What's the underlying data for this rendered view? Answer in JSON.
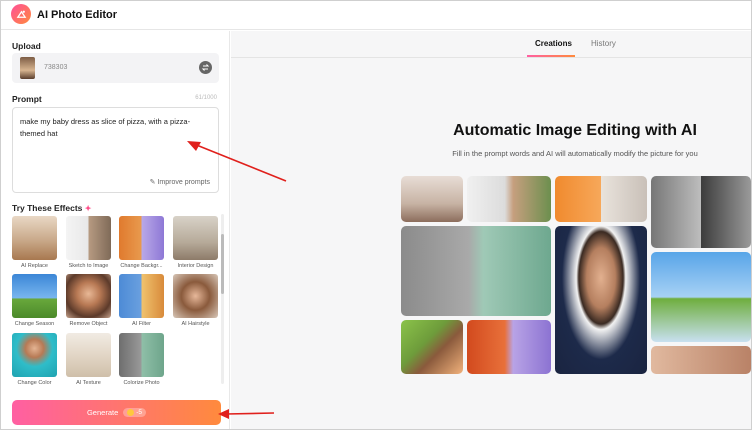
{
  "app": {
    "title": "AI Photo Editor"
  },
  "upload": {
    "label": "Upload",
    "file_name": "738303"
  },
  "prompt": {
    "label": "Prompt",
    "counter": "61/1000",
    "text": "make my baby dress as slice of pizza, with a pizza-themed hat",
    "improve_label": "Improve prompts"
  },
  "effects": {
    "label": "Try These Effects",
    "items": [
      {
        "label": "AI Replace"
      },
      {
        "label": "Sketch to Image"
      },
      {
        "label": "Change Backgr..."
      },
      {
        "label": "Interior Design"
      },
      {
        "label": "Change Season"
      },
      {
        "label": "Remove Object"
      },
      {
        "label": "AI Filter"
      },
      {
        "label": "AI Hairstyle"
      },
      {
        "label": "Change Color"
      },
      {
        "label": "AI Texture"
      },
      {
        "label": "Colorize Photo"
      }
    ]
  },
  "generate": {
    "label": "Generate",
    "cost": "-5"
  },
  "tabs": [
    {
      "label": "Creations"
    },
    {
      "label": "History"
    }
  ],
  "hero": {
    "title": "Automatic Image Editing with AI",
    "subtitle": "Fill in the prompt words and AI will automatically modify the picture for you"
  },
  "colors": {
    "accent_start": "#ff5fa2",
    "accent_end": "#ff8a3d",
    "annotation_arrow": "#e0201c"
  }
}
